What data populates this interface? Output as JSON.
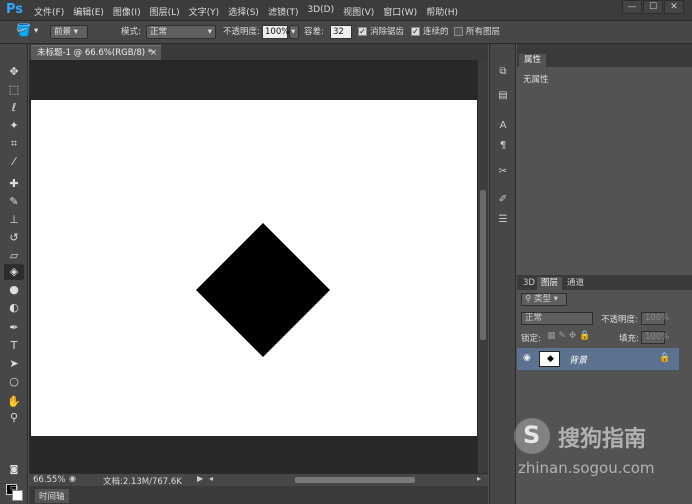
{
  "app": {
    "logo": "Ps"
  },
  "menu": [
    "文件(F)",
    "编辑(E)",
    "图像(I)",
    "图层(L)",
    "文字(Y)",
    "选择(S)",
    "滤镜(T)",
    "3D(D)",
    "视图(V)",
    "窗口(W)",
    "帮助(H)"
  ],
  "window_controls": {
    "minimize": "—",
    "restore": "☐",
    "close": "✕"
  },
  "options": {
    "fill_source": "前景",
    "mode_label": "模式:",
    "mode_value": "正常",
    "opacity_label": "不透明度:",
    "opacity_value": "100%",
    "tolerance_label": "容差:",
    "tolerance_value": "32",
    "antialias": "消除锯齿",
    "contiguous": "连续的",
    "all_layers": "所有图层"
  },
  "document": {
    "tab_title": "未标题-1 @ 66.6%(RGB/8) *",
    "close": "×"
  },
  "status": {
    "zoom": "66.55%",
    "doc_info": "文档:2.13M/767.6K"
  },
  "timeline": {
    "label": "时间轴"
  },
  "properties": {
    "tab": "属性",
    "content": "无属性"
  },
  "layers": {
    "tabs": [
      "3D",
      "图层",
      "通道"
    ],
    "filter_kind": "类型",
    "blend_mode": "正常",
    "opacity_label": "不透明度:",
    "opacity_value": "100%",
    "lock_label": "锁定:",
    "fill_label": "填充:",
    "fill_value": "100%",
    "layer_name": "背景"
  },
  "watermark": {
    "logo_letter": "S",
    "brand": "搜狗指南",
    "url": "zhinan.sogou.com"
  },
  "tools": [
    "move-tool",
    "marquee-tool",
    "lasso-tool",
    "magic-wand-tool",
    "crop-tool",
    "eyedropper-tool",
    "healing-brush-tool",
    "brush-tool",
    "clone-stamp-tool",
    "history-brush-tool",
    "eraser-tool",
    "paint-bucket-tool",
    "blur-tool",
    "dodge-tool",
    "pen-tool",
    "type-tool",
    "path-selection-tool",
    "shape-tool",
    "hand-tool",
    "zoom-tool"
  ],
  "colors": {
    "accent": "#31a8ff",
    "layer_selected": "#5d7190",
    "canvas": "#ffffff",
    "shape": "#000000"
  }
}
